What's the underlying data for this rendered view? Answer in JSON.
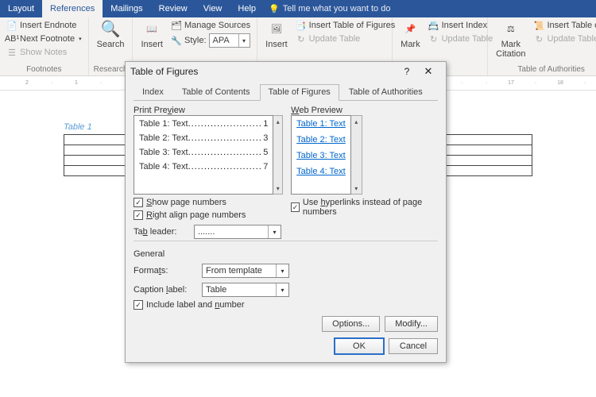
{
  "tabs": {
    "layout": "Layout",
    "references": "References",
    "mailings": "Mailings",
    "review": "Review",
    "view": "View",
    "help": "Help",
    "tellme": "Tell me what you want to do"
  },
  "ribbon": {
    "footnotes": {
      "insert_endnote": "Insert Endnote",
      "next_footnote": "Next Footnote",
      "show_notes": "Show Notes",
      "label": "Footnotes"
    },
    "research": {
      "search": "Search",
      "label": "Research"
    },
    "citations": {
      "insert": "Insert",
      "manage": "Manage Sources",
      "style": "Style:",
      "style_val": "APA"
    },
    "captions": {
      "insert": "Insert",
      "insert_tof": "Insert Table of Figures",
      "update": "Update Table"
    },
    "index": {
      "mark": "Mark",
      "insert": "Insert Index",
      "update": "Update Table"
    },
    "toa": {
      "mark": "Mark",
      "citation": "Citation",
      "insert": "Insert Table of Auth",
      "update": "Update Table",
      "label": "Table of Authorities"
    }
  },
  "doc": {
    "caption": "Table 1"
  },
  "dialog": {
    "title": "Table of Figures",
    "tabs": {
      "index": "Index",
      "toc": "Table of Contents",
      "tof": "Table of Figures",
      "toa": "Table of Authorities"
    },
    "print_preview": "Print Preview",
    "web_preview": "Web Preview",
    "pp": [
      {
        "t": "Table 1: Text",
        "p": "1"
      },
      {
        "t": "Table 2: Text",
        "p": "3"
      },
      {
        "t": "Table 3: Text",
        "p": "5"
      },
      {
        "t": "Table 4: Text",
        "p": "7"
      }
    ],
    "wp": [
      "Table 1: Text",
      "Table 2: Text",
      "Table 3: Text",
      "Table 4: Text"
    ],
    "show_pn": "Show page numbers",
    "right_align": "Right align page numbers",
    "use_hyper": "Use hyperlinks instead of page numbers",
    "tab_leader": "Tab leader:",
    "tab_leader_val": ".......",
    "general": "General",
    "formats": "Formats:",
    "formats_val": "From template",
    "caption_label": "Caption label:",
    "caption_val": "Table",
    "include": "Include label and number",
    "options": "Options...",
    "modify": "Modify...",
    "ok": "OK",
    "cancel": "Cancel"
  }
}
